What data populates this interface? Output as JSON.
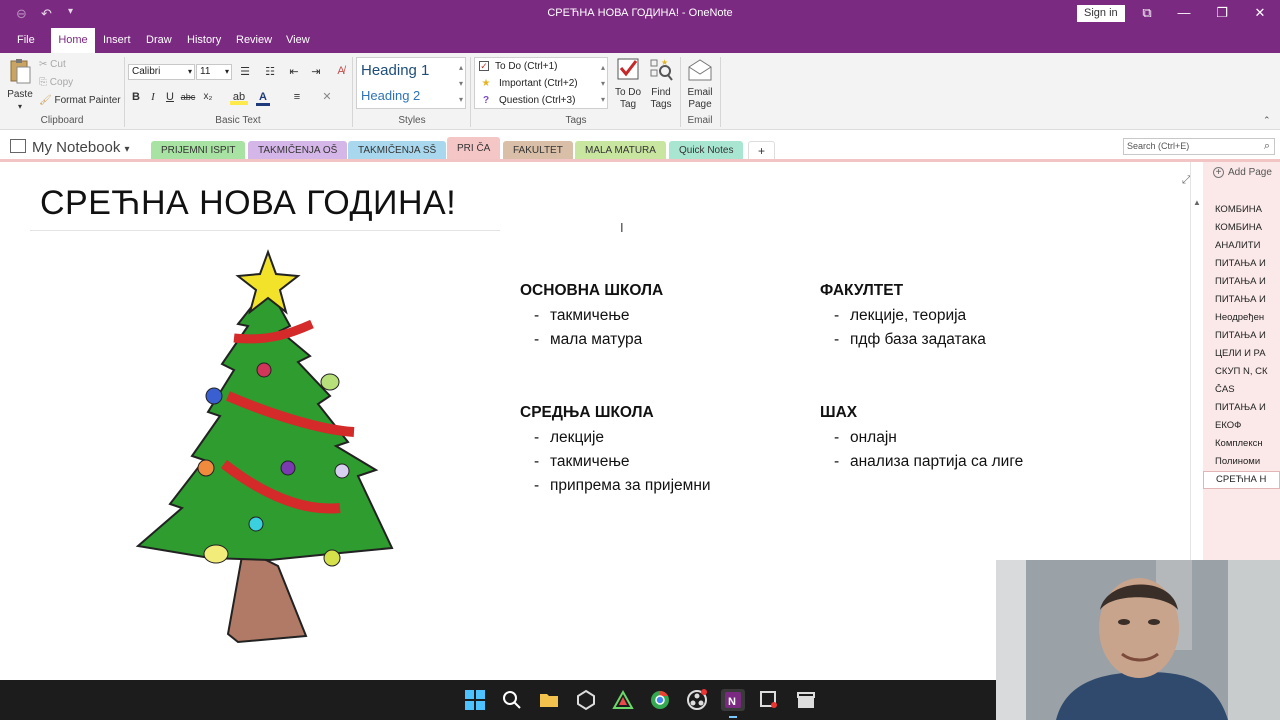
{
  "window": {
    "title": "СРЕЋНА НОВА ГОДИНА!  -  OneNote",
    "sign_in": "Sign in"
  },
  "menu": [
    "File",
    "Home",
    "Insert",
    "Draw",
    "History",
    "Review",
    "View"
  ],
  "ribbon": {
    "clipboard": {
      "paste": "Paste",
      "cut": "Cut",
      "copy": "Copy",
      "format_painter": "Format Painter",
      "label": "Clipboard"
    },
    "basic_text": {
      "font": "Calibri",
      "size": "11",
      "label": "Basic Text"
    },
    "styles": {
      "h1": "Heading 1",
      "h2": "Heading 2",
      "label": "Styles"
    },
    "tags": {
      "items": [
        "To Do (Ctrl+1)",
        "Important (Ctrl+2)",
        "Question (Ctrl+3)"
      ],
      "todo_tag": "To Do Tag",
      "find_tags": "Find Tags",
      "label": "Tags"
    },
    "email": {
      "button": "Email Page",
      "label": "Email"
    }
  },
  "notebook": {
    "name": "My Notebook",
    "sections": [
      {
        "label": "PRIJEMNI ISPIT",
        "color": "#a9e3a3"
      },
      {
        "label": "TAKMIČENJA OŠ",
        "color": "#d5b6e8"
      },
      {
        "label": "TAKMIČENJA SŠ",
        "color": "#a9d8ee"
      },
      {
        "label": "PRI ČA",
        "color": "#f5c6c6"
      },
      {
        "label": "FAKULTET",
        "color": "#d9bfa8"
      },
      {
        "label": "MALA MATURA",
        "color": "#c9e6a1"
      },
      {
        "label": "Quick Notes",
        "color": "#a9e6d2"
      }
    ],
    "add_section": "+",
    "search_placeholder": "Search (Ctrl+E)"
  },
  "page": {
    "title": "СРЕЋНА НОВА ГОДИНА!",
    "blocks": [
      {
        "heading": "ОСНОВНА ШКОЛА",
        "items": [
          "такмичење",
          "мала матура"
        ]
      },
      {
        "heading": "ФАКУЛТЕТ",
        "items": [
          "лекције, теорија",
          "пдф база задатака"
        ]
      },
      {
        "heading": "СРЕДЊА ШКОЛА",
        "items": [
          "лекције",
          "такмичење",
          "припрема за пријемни"
        ]
      },
      {
        "heading": "ШАХ",
        "items": [
          "онлајн",
          "анализа партија са лиге"
        ]
      }
    ]
  },
  "pages": {
    "add_page": "Add Page",
    "items": [
      "КОМБИНА",
      "КОМБИНА",
      "АНАЛИТИ",
      "ПИТАЊА И",
      "ПИТАЊА И",
      "ПИТАЊА И",
      "Неодређен",
      "ПИТАЊА И",
      "ЦЕЛИ И РА",
      "СКУП N, СК",
      "ČAS",
      "ПИТАЊА И",
      "ЕКОФ",
      "Комплексн",
      "Полиноми",
      "СРЕЋНА Н"
    ],
    "active_index": 15
  },
  "colors": {
    "accent": "#7b2a82",
    "tree_green": "#2e9c2e",
    "garland_red": "#d42a2a",
    "trunk": "#b07a66"
  },
  "taskbar": {
    "icons": [
      "windows-icon",
      "search-icon",
      "file-explorer-icon",
      "app-cube-icon",
      "triangle-app-icon",
      "chrome-icon",
      "obs-icon",
      "onenote-icon",
      "snipping-icon",
      "clapper-icon"
    ]
  }
}
